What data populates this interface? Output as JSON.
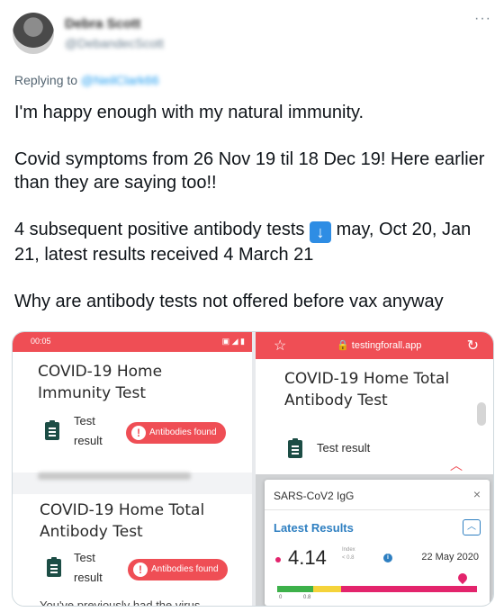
{
  "tweet": {
    "author_name": "Debra Scott",
    "author_handle": "@DebandecScott",
    "more_icon": "more-horizontal-icon",
    "replying_prefix": "Replying to",
    "replying_handle": "@NeilClark66",
    "paragraphs": {
      "p1": "I'm happy enough with my natural immunity.",
      "p2": "Covid symptoms from 26 Nov 19 til 18 Dec 19! Here earlier than they are saying too!!",
      "p3a": "4 subsequent positive antibody tests",
      "p3b": "may, Oct 20, Jan 21, latest results received 4 March 21",
      "p4": "Why are antibody tests not offered before vax anyway"
    }
  },
  "media": {
    "left": {
      "status_time": "00:05",
      "card1_title": "COVID-19 Home Immunity Test",
      "card1_label": "Test result",
      "card1_badge": "Antibodies found",
      "card2_title": "COVID-19 Home Total Antibody Test",
      "card2_label": "Test result",
      "card2_badge": "Antibodies found",
      "card2_footer": "You've previously had the virus"
    },
    "right": {
      "url": "testingforall.app",
      "card_title": "COVID-19 Home Total Antibody Test",
      "card_label": "Test result",
      "popup_title": "SARS-CoV2 IgG",
      "latest_label": "Latest Results",
      "value": "4.14",
      "index_label": "Index",
      "index_threshold": "< 0.8",
      "date": "22 May 2020",
      "gauge_labels": [
        "0",
        "0.8"
      ],
      "gauge_level": 0.93
    },
    "colors": {
      "brand_red": "#ef4e55",
      "accent_blue": "#2e7fc1",
      "marker_pink": "#e3246c",
      "gauge_green": "#3db14a",
      "gauge_yellow": "#f5d33a"
    }
  }
}
